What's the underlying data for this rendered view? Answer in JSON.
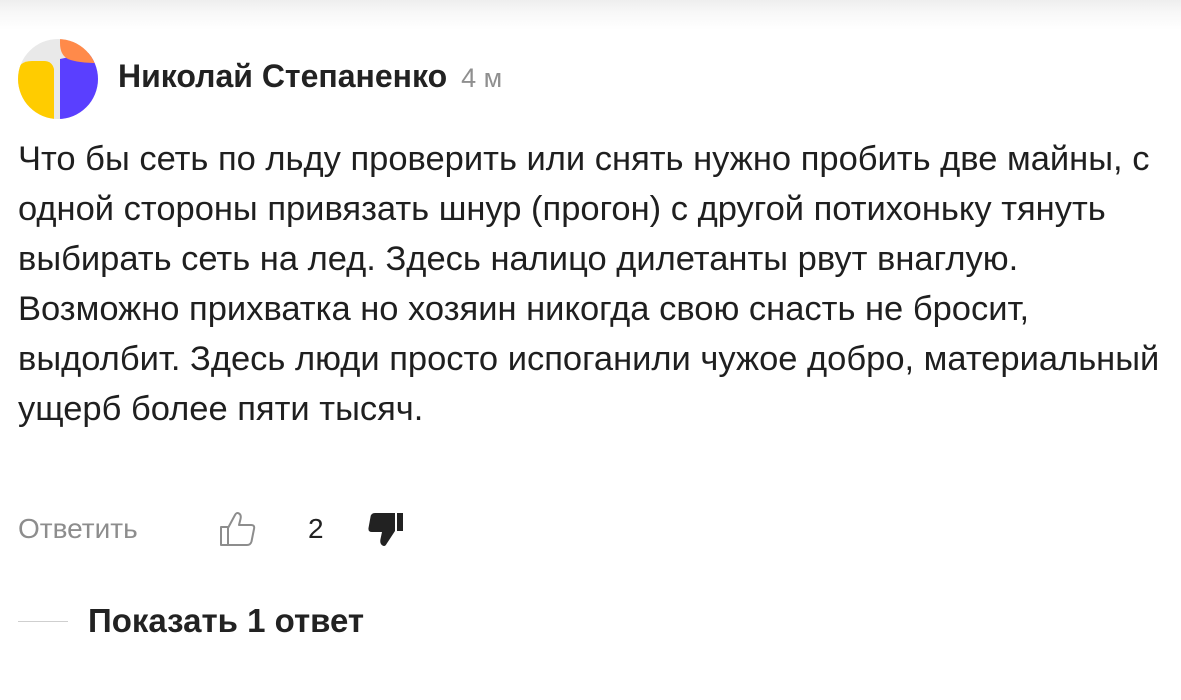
{
  "comment": {
    "avatar_icon": "yandex-zen-avatar-icon",
    "author": "Николай Степаненко",
    "timestamp": "4 м",
    "text": "Что бы сеть по льду проверить или снять нужно пробить две майны, с одной стороны привязать шнур (прогон) с другой потихоньку тянуть выбирать сеть на лед. Здесь налицо дилетанты рвут внаглую. Возможно прихватка но хозяин никогда свою снасть не бросит, выдолбит. Здесь люди просто испоганили чужое добро, материальный ущерб более пяти тысяч."
  },
  "actions": {
    "reply_label": "Ответить",
    "like_icon": "thumbs-up-icon",
    "like_count": "2",
    "dislike_icon": "thumbs-down-icon"
  },
  "replies": {
    "show_label": "Показать 1 ответ"
  },
  "colors": {
    "avatar_yellow": "#ffcc00",
    "avatar_purple": "#5a3fff",
    "avatar_orange": "#ff8a4a",
    "avatar_gray": "#e9e9e9",
    "text": "#1f1f1f",
    "muted": "#8d8d8d"
  }
}
